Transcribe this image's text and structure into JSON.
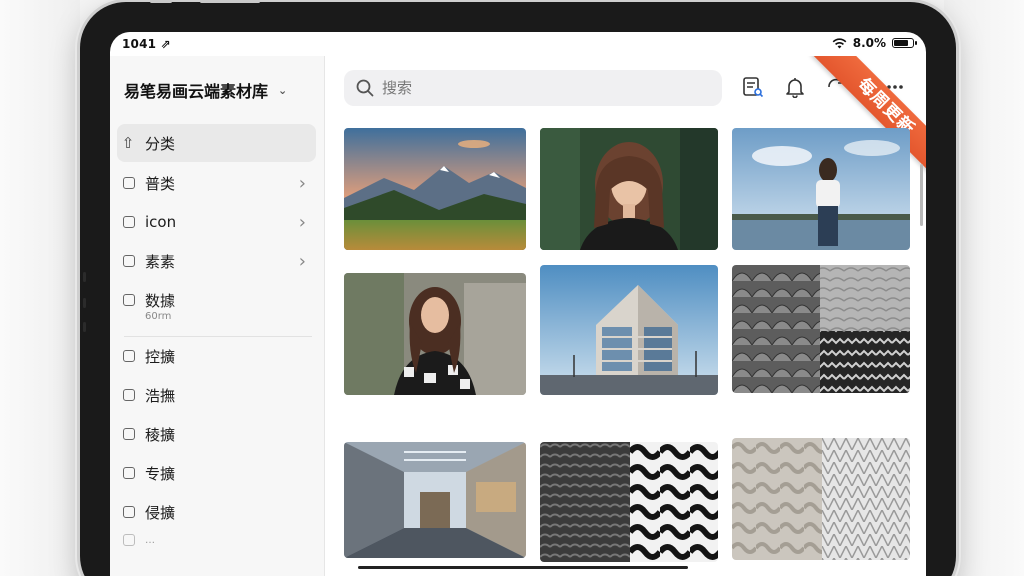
{
  "status": {
    "time": "1041",
    "time_suffix": "⇗",
    "battery_text": "8.0%",
    "battery_level": 0.8
  },
  "library": {
    "title": "易笔易画云端素材库"
  },
  "sidebar": {
    "items": [
      {
        "label": "分类",
        "active": true
      },
      {
        "label": "普类",
        "has_chevron": true
      },
      {
        "label": "icon",
        "has_chevron": true
      },
      {
        "label": "素素",
        "has_chevron": true
      },
      {
        "label": "数據",
        "sub": "60rm"
      },
      {
        "label": "控擴"
      },
      {
        "label": "浩撫"
      },
      {
        "label": "稜擴"
      },
      {
        "label": "专擴"
      },
      {
        "label": "侵擴"
      },
      {
        "label": "…"
      }
    ]
  },
  "search": {
    "placeholder": "搜索"
  },
  "toolbar": {
    "icons": [
      "list-search-icon",
      "bell-icon",
      "refresh-icon",
      "more-icon"
    ]
  },
  "ribbon": {
    "text": "每周更新"
  },
  "grid": {
    "items": [
      {
        "name": "mountain-landscape"
      },
      {
        "name": "woman-portrait-forest"
      },
      {
        "name": "woman-by-lake"
      },
      {
        "name": "woman-portrait-city"
      },
      {
        "name": "modern-building"
      },
      {
        "name": "gray-texture"
      },
      {
        "name": "interior-atrium"
      },
      {
        "name": "wave-pattern"
      },
      {
        "name": "stone-texture"
      }
    ]
  }
}
